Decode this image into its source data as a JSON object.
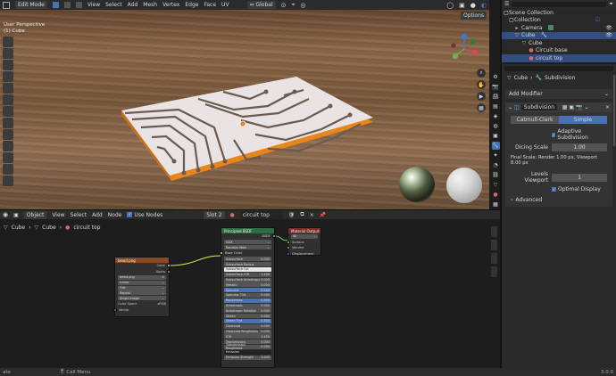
{
  "viewport_header": {
    "mode": "Edit Mode",
    "menus": [
      "View",
      "Select",
      "Add",
      "Mesh",
      "Vertex",
      "Edge",
      "Face",
      "UV"
    ],
    "orientation": "Global",
    "options": "Options"
  },
  "viewport": {
    "view_name": "User Perspective",
    "object_name": "(1) Cube"
  },
  "outliner": {
    "items": [
      {
        "label": "Scene Collection",
        "indent": 0,
        "selected": false
      },
      {
        "label": "Collection",
        "indent": 1,
        "selected": false
      },
      {
        "label": "Camera",
        "indent": 2,
        "selected": false
      },
      {
        "label": "Cube",
        "indent": 2,
        "selected": true
      },
      {
        "label": "Cube",
        "indent": 3,
        "selected": false
      },
      {
        "label": "Circuit base",
        "indent": 4,
        "selected": false
      },
      {
        "label": "circuit top",
        "indent": 4,
        "selected": true
      }
    ]
  },
  "properties": {
    "breadcrumb_object": "Cube",
    "breadcrumb_modifier": "Subdivision",
    "add_modifier": "Add Modifier",
    "modifier_name": "Subdivision",
    "type_options": [
      "Catmull-Clark",
      "Simple"
    ],
    "adaptive_label": "Adaptive Subdivision",
    "dicing_label": "Dicing Scale",
    "dicing_value": "1.00",
    "final_scale": "Final Scale:  Render 1.00 px, Viewport 8.00 px",
    "levels_label": "Levels Viewport",
    "levels_value": "1",
    "optimal_label": "Optimal Display",
    "advanced_label": "Advanced"
  },
  "node_header": {
    "type": "Object",
    "menus": [
      "View",
      "Select",
      "Add",
      "Node"
    ],
    "use_nodes": "Use Nodes",
    "slot": "Slot 2",
    "material": "circuit top"
  },
  "node_breadcrumb": [
    "Cube",
    "Cube",
    "circuit top"
  ],
  "image_node": {
    "title": "bewd.png",
    "outputs": [
      "Color",
      "Alpha"
    ],
    "image_name": "bewd.png",
    "rows": [
      "Linear",
      "Flat",
      "Repeat",
      "Single Image"
    ],
    "color_space_label": "Color Space",
    "color_space_value": "sRGB",
    "vector_label": "Vector"
  },
  "bsdf_node": {
    "title": "Principled BSDF",
    "output": "BSDF",
    "dropdowns": [
      "GGX",
      "Random Walk"
    ],
    "base_color": "Base Color",
    "params": [
      {
        "label": "Subsurface",
        "value": "0.000",
        "style": "grey"
      },
      {
        "label": "Subsurface Radius",
        "value": "",
        "style": "grey"
      },
      {
        "label": "Subsurface Col",
        "value": "",
        "style": "white"
      },
      {
        "label": "Subsurface IOR",
        "value": "1.400",
        "style": "grey"
      },
      {
        "label": "Subsurface Anisotropy",
        "value": "0.000",
        "style": "grey"
      },
      {
        "label": "Metallic",
        "value": "0.000",
        "style": "grey"
      },
      {
        "label": "Specular",
        "value": "0.500",
        "style": "blue"
      },
      {
        "label": "Specular Tint",
        "value": "0.000",
        "style": "grey"
      },
      {
        "label": "Roughness",
        "value": "0.500",
        "style": "blue"
      },
      {
        "label": "Anisotropic",
        "value": "0.000",
        "style": "grey"
      },
      {
        "label": "Anisotropic Rotation",
        "value": "0.000",
        "style": "grey"
      },
      {
        "label": "Sheen",
        "value": "0.000",
        "style": "grey"
      },
      {
        "label": "Sheen Tint",
        "value": "0.500",
        "style": "blue"
      },
      {
        "label": "Clearcoat",
        "value": "0.000",
        "style": "grey"
      },
      {
        "label": "Clearcoat Roughness",
        "value": "0.030",
        "style": "grey"
      },
      {
        "label": "IOR",
        "value": "1.450",
        "style": "grey"
      },
      {
        "label": "Transmission",
        "value": "0.000",
        "style": "grey"
      },
      {
        "label": "Transmission Roughness",
        "value": "0.000",
        "style": "grey"
      },
      {
        "label": "Emission",
        "value": "",
        "style": "dark"
      },
      {
        "label": "Emission Strength",
        "value": "1.000",
        "style": "grey"
      }
    ]
  },
  "output_node": {
    "title": "Material Output",
    "target": "All",
    "inputs": [
      "Surface",
      "Volume",
      "Displacement"
    ]
  },
  "status_bar": {
    "left": "ate",
    "center": "Call Menu",
    "version": "3.0.0"
  },
  "colors": {
    "accent_blue": "#4772b3",
    "selection": "#334d80",
    "board_edge": "#e8861a",
    "node_bsdf_header": "#2f6b42",
    "node_image_header": "#8a4a24",
    "node_output_header": "#7a2b2b"
  }
}
